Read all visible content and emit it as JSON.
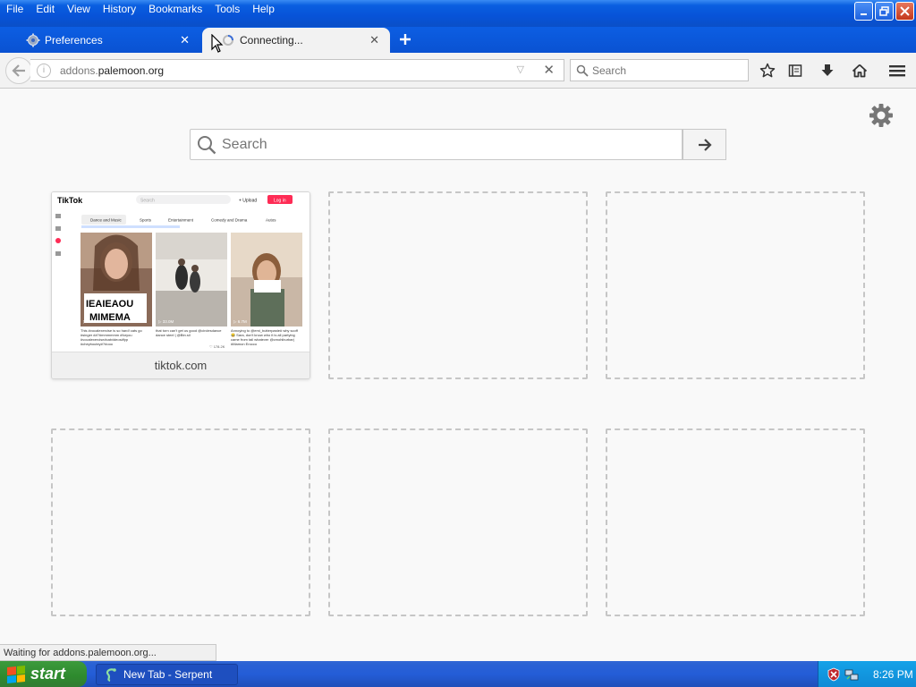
{
  "menu": {
    "file": "File",
    "edit": "Edit",
    "view": "View",
    "history": "History",
    "bookmarks": "Bookmarks",
    "tools": "Tools",
    "help": "Help"
  },
  "tabs": [
    {
      "label": "Preferences",
      "icon": "gear-icon"
    },
    {
      "label": "Connecting...",
      "icon": "loading-icon",
      "active": true
    }
  ],
  "navbar": {
    "url_prefix": "addons.",
    "url_domain": "palemoon.org",
    "search_placeholder": "Search"
  },
  "newtab": {
    "search_placeholder": "Search",
    "tiles": [
      {
        "title": "tiktok.com",
        "filled": true
      }
    ]
  },
  "thumbnail": {
    "brand": "TikTok",
    "search_hint": "Search",
    "upload": "+ Upload",
    "login": "Log in",
    "categories": [
      "Dance and Music",
      "Sports",
      "Entertainment",
      "Comedy and Drama",
      "Autos"
    ],
    "video1_overlay_line1": "IEAIEAOU",
    "video1_overlay_line2": "MIMEMA",
    "video1_caption": "This #vocalexercise is so hard! cats go #singer ##?#mmmmmm #foryou #vocalexercise#catvideos#fyp #cheyboutey#?#ooo",
    "video2_caption": "that torn can't get us good @circlesdance dance steel | @Btn.sil",
    "video3_caption": "Annoying to @emi_butterpaste# why scoff 😂 Sara, don't know who it is all partying came from tail whatever @cmohiburbar| #Mamon Erocco",
    "video1_views": "▷ 2.0M",
    "video2_views": "▷ 33.0M",
    "video3_views": "▷ 6.7M",
    "video2_likes": "♡ 178.2K"
  },
  "status": {
    "text": "Waiting for addons.palemoon.org..."
  },
  "taskbar": {
    "start": "start",
    "task_label": "New Tab - Serpent",
    "clock": "8:26 PM"
  },
  "colors": {
    "titlebar": "#0753d8",
    "start_green": "#2e8a2e",
    "tray_blue": "#0f8bd6",
    "tiktok_red": "#fe2c55"
  }
}
